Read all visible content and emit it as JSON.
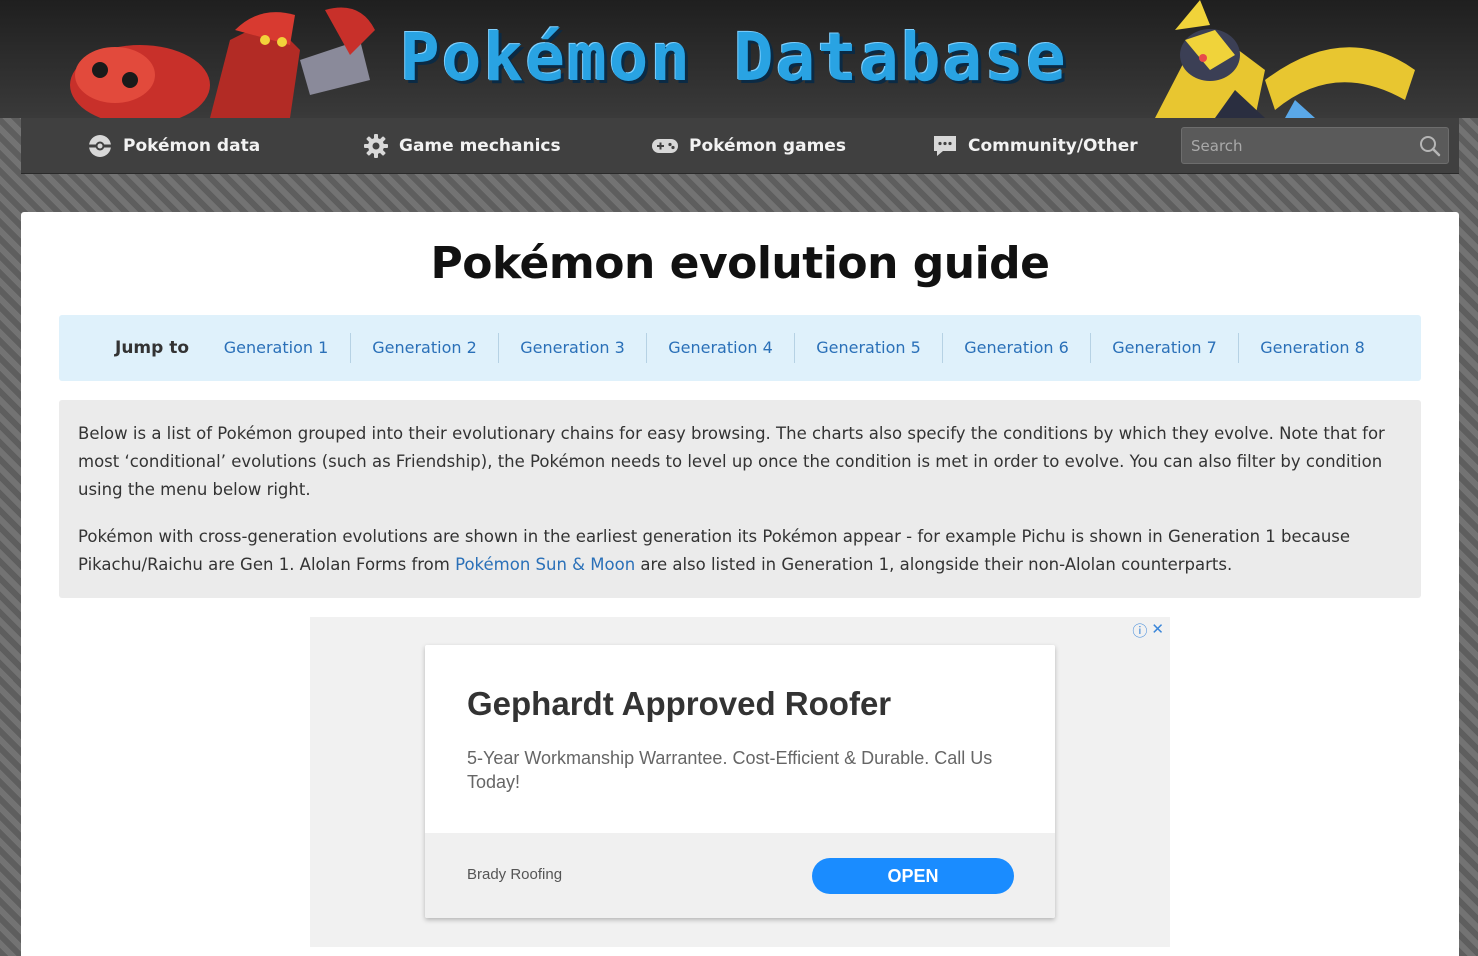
{
  "header": {
    "logo_text": "Pokémon Database"
  },
  "nav": {
    "items": [
      {
        "label": "Pokémon data",
        "icon": "pokeball-icon"
      },
      {
        "label": "Game mechanics",
        "icon": "gear-icon"
      },
      {
        "label": "Pokémon games",
        "icon": "gamepad-icon"
      },
      {
        "label": "Community/Other",
        "icon": "chat-bubble-icon"
      }
    ],
    "search_placeholder": "Search"
  },
  "page": {
    "title": "Pokémon evolution guide",
    "jump": {
      "label": "Jump to",
      "generations": [
        "Generation 1",
        "Generation 2",
        "Generation 3",
        "Generation 4",
        "Generation 5",
        "Generation 6",
        "Generation 7",
        "Generation 8"
      ]
    },
    "intro": {
      "p1": "Below is a list of Pokémon grouped into their evolutionary chains for easy browsing. The charts also specify the conditions by which they evolve. Note that for most ‘conditional’ evolutions (such as Friendship), the Pokémon needs to level up once the condition is met in order to evolve. You can also filter by condition using the menu below right.",
      "p2_before": "Pokémon with cross-generation evolutions are shown in the earliest generation its Pokémon appear - for example Pichu is shown in Generation 1 because Pikachu/Raichu are Gen 1. Alolan Forms from ",
      "p2_link": "Pokémon Sun & Moon",
      "p2_after": " are also listed in Generation 1, alongside their non-Alolan counterparts."
    }
  },
  "ad": {
    "info_icon": "ⓘ",
    "close_icon": "✕",
    "headline": "Gephardt Approved Roofer",
    "description": "5-Year Workmanship Warrantee. Cost-Efficient & Durable. Call Us Today!",
    "advertiser": "Brady Roofing",
    "cta": "OPEN"
  },
  "colors": {
    "link": "#2a70b8",
    "logo": "#29a3e3",
    "cta": "#1a8cff"
  }
}
